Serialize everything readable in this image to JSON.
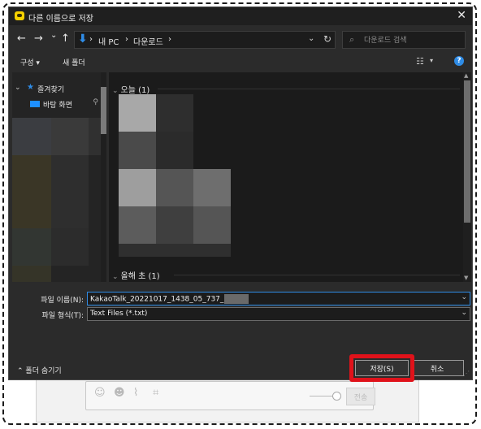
{
  "dialog": {
    "title": "다른 이름으로 저장",
    "close_glyph": "✕"
  },
  "nav": {
    "back_glyph": "←",
    "forward_glyph": "→",
    "recent_glyph": "⌄",
    "up_glyph": "↑",
    "breadcrumb": [
      "내 PC",
      "다운로드"
    ],
    "separator": "›",
    "refresh_glyph": "↻",
    "dropdown_glyph": "⌄"
  },
  "search": {
    "placeholder": "다운로드 검색",
    "icon_glyph": "⌕"
  },
  "toolbar": {
    "organize_label": "구성 ▾",
    "new_folder_label": "새 폴더",
    "view_glyph": "☷",
    "view_drop_glyph": "▾",
    "help_glyph": "?"
  },
  "sidebar": {
    "items": [
      {
        "label": "즐겨찾기",
        "icon": "star-icon",
        "expanded": true
      },
      {
        "label": "바탕 화면",
        "icon": "folder-icon",
        "pinned": true
      }
    ]
  },
  "file_groups": [
    {
      "label": "오늘 (1)"
    },
    {
      "label": "올해 초 (1)"
    }
  ],
  "form": {
    "filename_label": "파일 이름(N):",
    "filename_value": "KakaoTalk_20221017_1438_05_737_",
    "filetype_label": "파일 형식(T):",
    "filetype_value": "Text Files (*.txt)",
    "hide_folders_label": "폴더 숨기기",
    "save_label": "저장(S)",
    "cancel_label": "취소"
  },
  "background_chat": {
    "send_label": "전송"
  },
  "colors": {
    "accent": "#2f8ce6",
    "highlight": "#e0121a",
    "dialog_bg": "#2b2b2b"
  }
}
